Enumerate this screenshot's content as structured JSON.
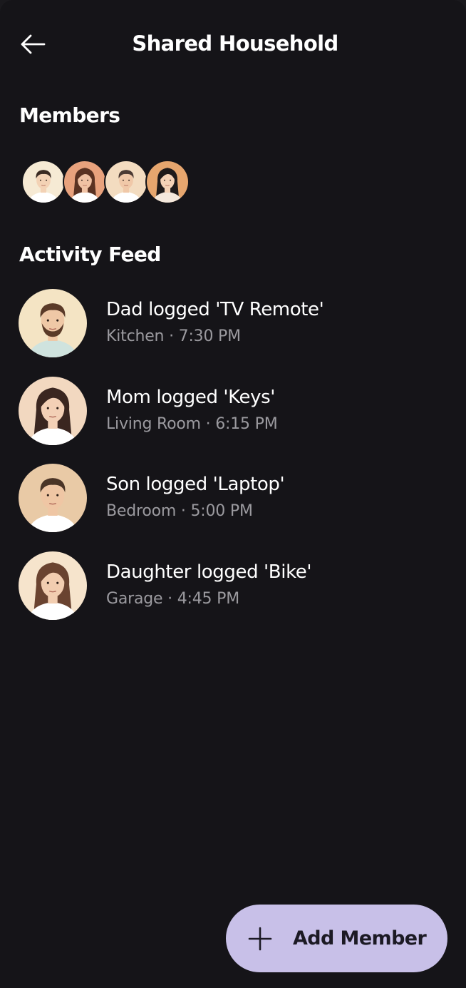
{
  "header": {
    "title": "Shared Household",
    "back_icon": "arrow-left-icon"
  },
  "members": {
    "title": "Members",
    "avatars": [
      {
        "name": "member-avatar-1",
        "skin": "#f3d2b5",
        "hair": "#3a2a22",
        "bg": "#f6ead4",
        "shirt": "#ffffff"
      },
      {
        "name": "member-avatar-2",
        "skin": "#f0c2a4",
        "hair": "#5a3222",
        "bg": "#e8a27d",
        "shirt": "#ffffff"
      },
      {
        "name": "member-avatar-3",
        "skin": "#f0c8a8",
        "hair": "#4b3a33",
        "bg": "#f3dcc0",
        "shirt": "#ffffff"
      },
      {
        "name": "member-avatar-4",
        "skin": "#f4d2b6",
        "hair": "#1e1a1a",
        "bg": "#e6a66e",
        "shirt": "#f4e8dc"
      }
    ]
  },
  "activity": {
    "title": "Activity Feed",
    "items": [
      {
        "title": "Dad logged 'TV Remote'",
        "sub": "Kitchen · 7:30 PM",
        "skin": "#efc8a6",
        "hair": "#5a3a28",
        "bg": "#f4e4c4",
        "shirt": "#cfe3de",
        "beard": true
      },
      {
        "title": "Mom logged 'Keys'",
        "sub": "Living Room · 6:15 PM",
        "skin": "#f3d0b6",
        "hair": "#3a2620",
        "bg": "#f2d8c0",
        "shirt": "#ffffff",
        "beard": false
      },
      {
        "title": "Son logged 'Laptop'",
        "sub": "Bedroom · 5:00 PM",
        "skin": "#efc6a4",
        "hair": "#4a3426",
        "bg": "#e9caa6",
        "shirt": "#ffffff",
        "beard": false
      },
      {
        "title": "Daughter logged 'Bike'",
        "sub": "Garage · 4:45 PM",
        "skin": "#f2cdb0",
        "hair": "#6a4330",
        "bg": "#f6e4cc",
        "shirt": "#ffffff",
        "beard": false
      }
    ]
  },
  "fab": {
    "label": "Add Member",
    "icon": "plus-icon"
  },
  "colors": {
    "background": "#151418",
    "accent": "#c8c0e8",
    "subtext": "#9b9a9f"
  }
}
